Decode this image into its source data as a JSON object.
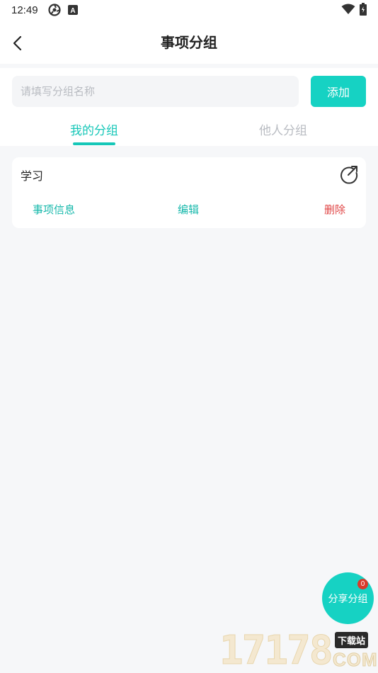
{
  "status_bar": {
    "time": "12:49",
    "icons": [
      "hotspot-icon",
      "keyboard-a-icon",
      "wifi-icon",
      "battery-icon"
    ],
    "keyboard_letter": "A"
  },
  "header": {
    "title": "事项分组",
    "back_icon": "chevron-left-icon"
  },
  "add_group": {
    "placeholder": "请填写分组名称",
    "value": "",
    "button_label": "添加"
  },
  "tabs": [
    {
      "label": "我的分组",
      "active": true
    },
    {
      "label": "他人分组",
      "active": false
    }
  ],
  "groups": [
    {
      "name": "学习",
      "share_icon": "share-out-icon",
      "actions": {
        "info": "事项信息",
        "edit": "编辑",
        "delete": "删除"
      }
    }
  ],
  "share_fab": {
    "label": "分享分组",
    "badge": "0"
  },
  "watermark": {
    "digits": "17178",
    "tag": "下载站",
    "suffix": "COM"
  },
  "colors": {
    "accent": "#16d2c3",
    "accent_text": "#16b8ab",
    "danger": "#e04444",
    "badge": "#d93a2b",
    "background": "#f6f7f9"
  }
}
